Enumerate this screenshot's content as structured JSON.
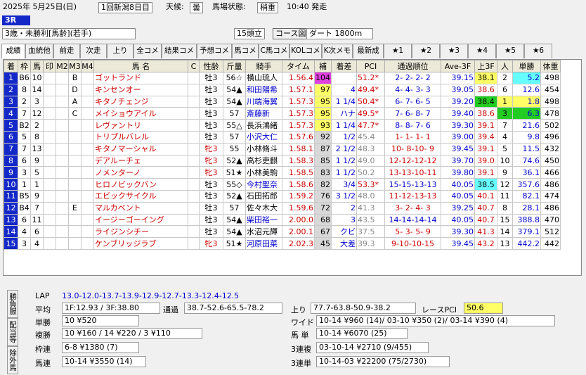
{
  "header": {
    "date": "2025年  5月25日(日)",
    "meeting": "1回新潟8日目",
    "weather_label": "天候:",
    "weather": "曇",
    "track_label": "馬場状態:",
    "track": "稍重",
    "start_time": "10:40 発走",
    "race_no": "3R",
    "condition": "3歳・未勝利[馬齢](若手)",
    "runners": "15頭立",
    "course_button": "コース図",
    "course": "ダート 1800m"
  },
  "tabs": [
    "成績",
    "血統他",
    "前走",
    "次走",
    "上り",
    "全コメ",
    "結果コメ",
    "予想コメ",
    "馬コメ",
    "C馬コメ",
    "KOLコメ",
    "K次メモ",
    "最新成",
    "★1",
    "★2",
    "★3",
    "★4",
    "★5",
    "★6"
  ],
  "columns": [
    "着",
    "枠",
    "馬",
    "印",
    "M2",
    "M3",
    "M4",
    "馬 名",
    "C",
    "性齢",
    "斤量",
    "騎手",
    "タイム",
    "補",
    "着差",
    "PCI",
    "通過順位",
    "Ave-3F",
    "上3F",
    "人",
    "単勝",
    "体重"
  ],
  "rows": [
    {
      "chaku": "1",
      "waku": "B6",
      "uma": "10",
      "in": "",
      "m2": "",
      "m3": "B",
      "m4": "",
      "name": "ゴットランド",
      "c": "",
      "sex": "牡3",
      "kin": "56☆",
      "jockey": "横山琉人",
      "time": "1.56.4",
      "ho": "104",
      "sa": "",
      "pci": "51.2*",
      "pos": "2- 2- 2- 2",
      "ave": "39.15",
      "agari": "38.1",
      "nin": "2",
      "odds": "5.2",
      "weight": "498"
    },
    {
      "chaku": "2",
      "waku": "8",
      "uma": "14",
      "in": "",
      "m2": "",
      "m3": "D",
      "m4": "",
      "name": "キンセンオー",
      "c": "",
      "sex": "牡3",
      "kin": "54▲",
      "jockey": "和田陽希",
      "time": "1.57.1",
      "ho": "97",
      "sa": "4",
      "pci": "49.4*",
      "pos": "4- 4- 3- 3",
      "ave": "39.05",
      "agari": "38.6",
      "nin": "6",
      "odds": "12.6",
      "weight": "454"
    },
    {
      "chaku": "3",
      "waku": "2",
      "uma": "3",
      "in": "",
      "m2": "",
      "m3": "A",
      "m4": "",
      "name": "キタノチェンジ",
      "c": "",
      "sex": "牡3",
      "kin": "54▲",
      "jockey": "川端海翼",
      "time": "1.57.3",
      "ho": "95",
      "sa": "1 1/4",
      "pci": "50.4*",
      "pos": "6- 7- 6- 5",
      "ave": "39.20",
      "agari": "38.4",
      "nin": "1",
      "odds": "1.8",
      "weight": "498"
    },
    {
      "chaku": "4",
      "waku": "7",
      "uma": "12",
      "in": "",
      "m2": "",
      "m3": "C",
      "m4": "",
      "name": "メイショウアイル",
      "c": "",
      "sex": "牡3",
      "kin": "57",
      "jockey": "斎藤新",
      "time": "1.57.3",
      "ho": "95",
      "sa": "ハナ",
      "pci": "49.5*",
      "pos": "7- 6- 8- 7",
      "ave": "39.40",
      "agari": "38.6",
      "nin": "3",
      "odds": "6.3",
      "weight": "478"
    },
    {
      "chaku": "5",
      "waku": "B2",
      "uma": "2",
      "in": "",
      "m2": "",
      "m3": "",
      "m4": "",
      "name": "レヴァントリ",
      "c": "",
      "sex": "牡3",
      "kin": "55△",
      "jockey": "長浜鴻緒",
      "time": "1.57.3",
      "ho": "93",
      "sa": "1 1/4",
      "pci": "47.7*",
      "pos": "8- 8- 7- 6",
      "ave": "39.30",
      "agari": "39.1",
      "nin": "7",
      "odds": "21.6",
      "weight": "502"
    },
    {
      "chaku": "6",
      "waku": "5",
      "uma": "8",
      "in": "",
      "m2": "",
      "m3": "",
      "m4": "",
      "name": "トリプルバレル",
      "c": "",
      "sex": "牡3",
      "kin": "57",
      "jockey": "小沢大仁",
      "time": "1.57.6",
      "ho": "92",
      "sa": "1/2",
      "pci": "45.4",
      "pos": "1- 1- 1- 1",
      "ave": "39.00",
      "agari": "39.4",
      "nin": "4",
      "odds": "9.8",
      "weight": "496"
    },
    {
      "chaku": "7",
      "waku": "7",
      "uma": "13",
      "in": "",
      "m2": "",
      "m3": "",
      "m4": "",
      "name": "キタノマーシャル",
      "c": "",
      "sex": "牝3",
      "kin": "55",
      "jockey": "小林脩斗",
      "time": "1.58.1",
      "ho": "87",
      "sa": "2 1/2",
      "pci": "48.3",
      "pos": "10- 8-10- 9",
      "ave": "39.45",
      "agari": "39.1",
      "nin": "5",
      "odds": "11.5",
      "weight": "432"
    },
    {
      "chaku": "8",
      "waku": "6",
      "uma": "9",
      "in": "",
      "m2": "",
      "m3": "",
      "m4": "",
      "name": "デアルーチェ",
      "c": "",
      "sex": "牝3",
      "kin": "52▲",
      "jockey": "高杉吏麒",
      "time": "1.58.3",
      "ho": "85",
      "sa": "1 1/2",
      "pci": "49.0",
      "pos": "12-12-12-12",
      "ave": "39.70",
      "agari": "39.0",
      "nin": "10",
      "odds": "74.6",
      "weight": "450"
    },
    {
      "chaku": "9",
      "waku": "3",
      "uma": "5",
      "in": "",
      "m2": "",
      "m3": "",
      "m4": "",
      "name": "ノメンターノ",
      "c": "",
      "sex": "牝3",
      "kin": "51★",
      "jockey": "小林美駒",
      "time": "1.58.5",
      "ho": "83",
      "sa": "1 1/2",
      "pci": "50.2",
      "pos": "13-13-10-11",
      "ave": "39.80",
      "agari": "39.1",
      "nin": "9",
      "odds": "36.1",
      "weight": "466"
    },
    {
      "chaku": "10",
      "waku": "1",
      "uma": "1",
      "in": "",
      "m2": "",
      "m3": "",
      "m4": "",
      "name": "ヒロノビックバン",
      "c": "",
      "sex": "牡3",
      "kin": "55◇",
      "jockey": "今村聖奈",
      "time": "1.58.6",
      "ho": "82",
      "sa": "3/4",
      "pci": "53.3*",
      "pos": "15-15-13-13",
      "ave": "40.05",
      "agari": "38.5",
      "nin": "12",
      "odds": "357.6",
      "weight": "486"
    },
    {
      "chaku": "11",
      "waku": "B5",
      "uma": "9",
      "in": "",
      "m2": "",
      "m3": "",
      "m4": "",
      "name": "エビックサイクル",
      "c": "",
      "sex": "牡3",
      "kin": "52▲",
      "jockey": "石田拓郎",
      "time": "1.59.2",
      "ho": "76",
      "sa": "3 1/2",
      "pci": "48.0",
      "pos": "11-12-13-13",
      "ave": "40.05",
      "agari": "40.1",
      "nin": "11",
      "odds": "82.1",
      "weight": "474"
    },
    {
      "chaku": "12",
      "waku": "B4",
      "uma": "7",
      "in": "",
      "m2": "",
      "m3": "E",
      "m4": "",
      "name": "マルカベント",
      "c": "",
      "sex": "牡3",
      "kin": "57",
      "jockey": "佐々木大",
      "time": "1.59.6",
      "ho": "72",
      "sa": "2",
      "pci": "41.3",
      "pos": "3- 2- 4- 3",
      "ave": "39.25",
      "agari": "40.7",
      "nin": "8",
      "odds": "28.1",
      "weight": "486"
    },
    {
      "chaku": "13",
      "waku": "6",
      "uma": "11",
      "in": "",
      "m2": "",
      "m3": "",
      "m4": "",
      "name": "イージーゴーイング",
      "c": "",
      "sex": "牡3",
      "kin": "54▲",
      "jockey": "柴田裕一",
      "time": "2.00.0",
      "ho": "68",
      "sa": "3",
      "pci": "43.5",
      "pos": "14-14-14-14",
      "ave": "40.05",
      "agari": "40.7",
      "nin": "15",
      "odds": "388.8",
      "weight": "470"
    },
    {
      "chaku": "14",
      "waku": "4",
      "uma": "6",
      "in": "",
      "m2": "",
      "m3": "",
      "m4": "",
      "name": "ライジンシチー",
      "c": "",
      "sex": "牡3",
      "kin": "54▲",
      "jockey": "水沼元輝",
      "time": "2.00.1",
      "ho": "67",
      "sa": "クビ",
      "pci": "37.5",
      "pos": "5- 3- 5- 9",
      "ave": "39.30",
      "agari": "41.3",
      "nin": "14",
      "odds": "379.1",
      "weight": "512"
    },
    {
      "chaku": "15",
      "waku": "3",
      "uma": "4",
      "in": "",
      "m2": "",
      "m3": "",
      "m4": "",
      "name": "ケンブリッジラブ",
      "c": "",
      "sex": "牝3",
      "kin": "51★",
      "jockey": "河原田菜",
      "time": "2.02.3",
      "ho": "45",
      "sa": "大差",
      "pci": "39.3",
      "pos": "9-10-10-15",
      "ave": "39.45",
      "agari": "43.2",
      "nin": "13",
      "odds": "442.2",
      "weight": "442"
    }
  ],
  "bottom": {
    "side_tabs": [
      "勝負服",
      "配当等",
      "除外馬"
    ],
    "lap_label": "LAP",
    "lap": "13.0-12.0-13.7-13.9-12.9-12.7-13.3-12.4-12.5",
    "avg_label": "平均",
    "avg": "1F:12.93 / 3F:38.80",
    "pass_label": "通過",
    "pass": "38.7-52.6-65.5-78.2",
    "agari_label": "上り",
    "agari": "77.7-63.8-50.9-38.2",
    "pci_label": "レースPCI",
    "pci": "50.6",
    "tan_label": "単勝",
    "tan": "10 ¥520",
    "fuku_label": "複勝",
    "fuku": "10 ¥160 / 14 ¥220 / 3 ¥110",
    "waku_label": "枠連",
    "waku": "6-8 ¥1380 (7)",
    "umaren_label": "馬連",
    "umaren": "10-14 ¥3550 (14)",
    "wide_label": "ワイド",
    "wide": "10-14 ¥960 (14)/ 03-10 ¥350 (2)/ 03-14 ¥390 (4)",
    "umatan_label": "馬 単",
    "umatan": "10-14 ¥6070 (25)",
    "sanrenpuku_label": "3連複",
    "sanrenpuku": "03-10-14 ¥2710 (9/455)",
    "sanrentan_label": "3連単",
    "sanrentan": "10-14-03 ¥22200 (75/2730)"
  },
  "colors": {
    "accent": "#1428c8",
    "yellow": "#ffff66",
    "green": "#22cc22",
    "cyan": "#66ffff",
    "pink": "#ffcccc"
  }
}
